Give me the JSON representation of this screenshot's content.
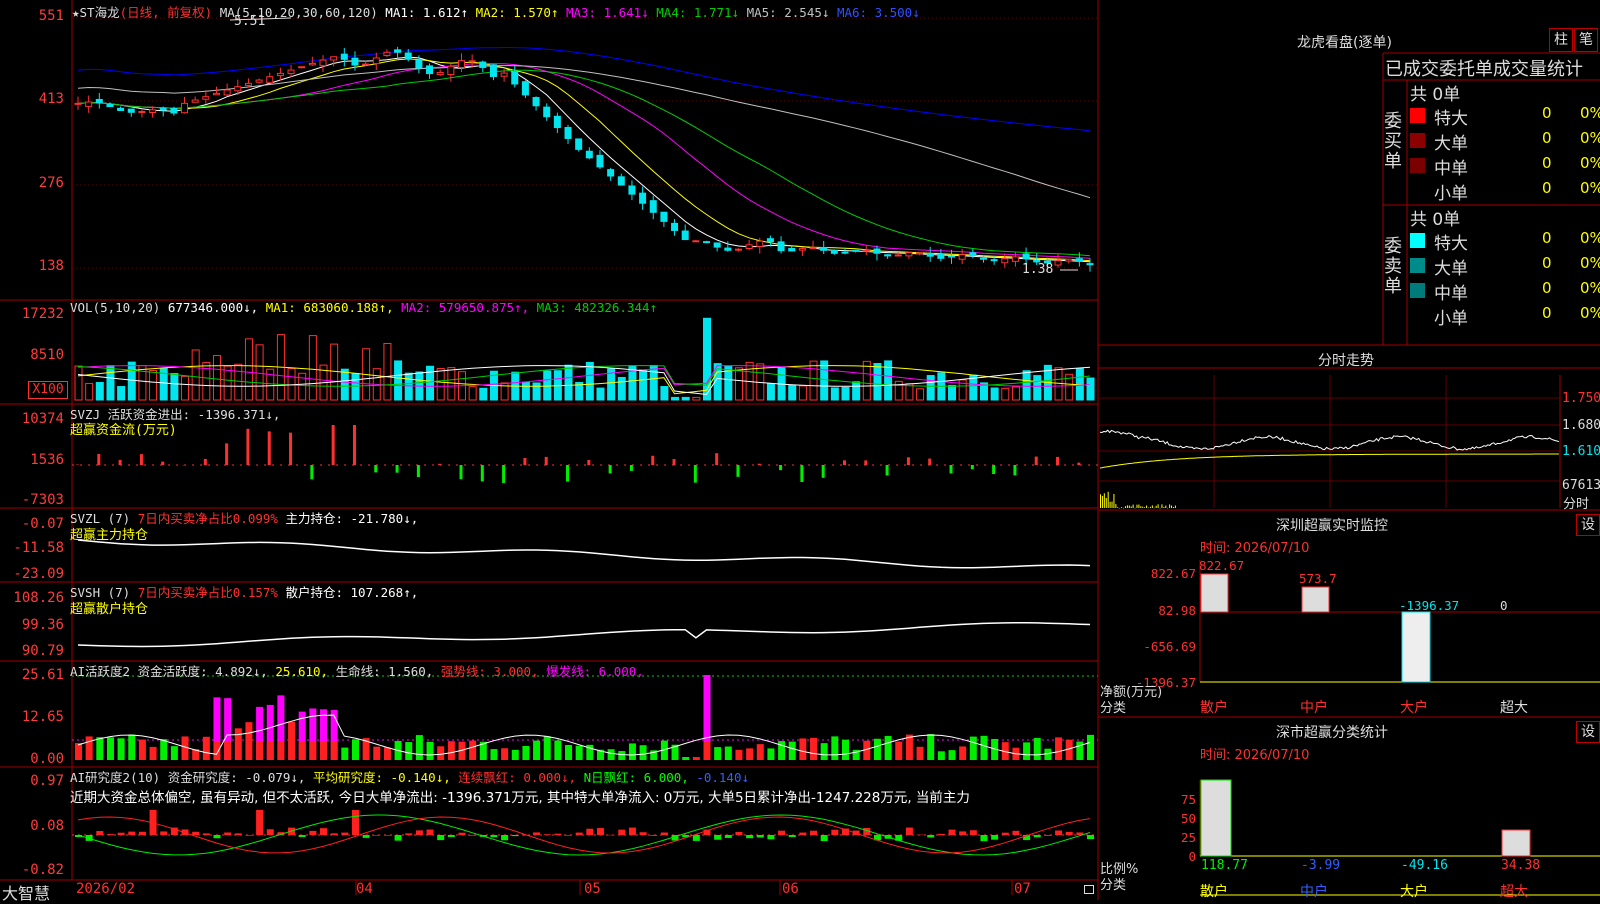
{
  "colors": {
    "up": "#ff3030",
    "down": "#00e5ee",
    "ma1": "#ffffff",
    "ma2": "#ffff00",
    "ma3": "#ff00ff",
    "ma4": "#00cc00",
    "ma5": "#c0c0c0",
    "ma6": "#0000ff",
    "border": "#a00000"
  },
  "main_chart": {
    "header_stock": "★ST海龙",
    "header_period": "(日线, 前复权)",
    "ma_param": "MA(5,10,20,30,60,120)",
    "ma1": "MA1: 1.612↑",
    "ma2": "MA2: 1.570↑",
    "ma3": "MA3: 1.641↓",
    "ma4": "MA4: 1.771↓",
    "ma5": "MA5: 2.545↓",
    "ma6": "MA6: 3.500↓",
    "y_labels": [
      "551",
      "413",
      "276",
      "138"
    ],
    "high_label": "5.51",
    "low_label": "1.38"
  },
  "vol_panel": {
    "header": "VOL(5,10,20)",
    "value": "677346.000↓,",
    "ma1": "MA1: 683060.188↑,",
    "ma2": "MA2: 579650.875↑,",
    "ma3": "MA3: 482326.344↑",
    "y_labels": [
      "17232",
      "8510"
    ],
    "unit": "X100"
  },
  "svzj_panel": {
    "header": "SVZJ  活跃资金进出: -1396.371↓,",
    "subtitle": "超赢资金流(万元)",
    "y_labels": [
      "10374",
      "1536",
      "-7303"
    ]
  },
  "svzl_panel": {
    "header1": "SVZL (7)",
    "header2": "7日内买卖净占比0.099%",
    "header3": "主力持仓: -21.780↓,",
    "subtitle": "超赢主力持仓",
    "y_labels": [
      "-0.07",
      "-11.58",
      "-23.09"
    ]
  },
  "svsh_panel": {
    "header1": "SVSH (7)",
    "header2": "7日内买卖净占比0.157%",
    "header3": "散户持仓: 107.268↑,",
    "subtitle": "超赢散户持仓",
    "y_labels": [
      "108.26",
      "99.36",
      "90.79"
    ]
  },
  "ai_active_panel": {
    "header1": "AI活跃度2 资金活跃度: 4.892↓,",
    "header2": "25.610,",
    "header3": "生命线: 1.560,",
    "header4": "强势线: 3.000,",
    "header5": "爆发线: 6.000,",
    "y_labels": [
      "25.61",
      "12.65",
      "0.00"
    ]
  },
  "ai_research_panel": {
    "header1": "AI研究度2(10) 资金研究度: -0.079↓,",
    "header2": "平均研究度: -0.140↓,",
    "header3": "连续飘红: 0.000↓,",
    "header4": "N日飘红: 6.000,",
    "header5": "-0.140↓",
    "comment": "近期大资金总体偏空, 虽有异动, 但不太活跃, 今日大单净流出: -1396.371万元, 其中特大单净流入: 0万元, 大单5日累计净出-1247.228万元, 当前主力",
    "y_labels": [
      "0.97",
      "0.08",
      "-0.82"
    ]
  },
  "x_axis": {
    "labels": [
      "2026/02",
      "04",
      "05",
      "06",
      "07"
    ],
    "logo": "大智慧"
  },
  "dragon_tiger": {
    "title": "龙虎看盘(逐单)",
    "btn1": "柱",
    "btn2": "笔",
    "subtitle": "已成交委托单成交量统计",
    "buy_label": "委买单",
    "sell_label": "委卖单",
    "buy_total": "共 0单",
    "sell_total": "共 0单",
    "buy_rows": [
      {
        "name": "特大",
        "count": "0",
        "pct": "0%",
        "color": "#ff0000"
      },
      {
        "name": "大单",
        "count": "0",
        "pct": "0%",
        "color": "#8b0000"
      },
      {
        "name": "中单",
        "count": "0",
        "pct": "0%",
        "color": "#7a0000"
      },
      {
        "name": "小单",
        "count": "0",
        "pct": "0%",
        "color": "#000000"
      }
    ],
    "sell_rows": [
      {
        "name": "特大",
        "count": "0",
        "pct": "0%",
        "color": "#00ffff"
      },
      {
        "name": "大单",
        "count": "0",
        "pct": "0%",
        "color": "#008b8b"
      },
      {
        "name": "中单",
        "count": "0",
        "pct": "0%",
        "color": "#007b7b"
      },
      {
        "name": "小单",
        "count": "0",
        "pct": "0%",
        "color": "#000000"
      }
    ]
  },
  "intraday": {
    "title": "分时走势",
    "y_labels": [
      "1.750",
      "1.680",
      "1.610",
      "67613"
    ],
    "unit": "分时"
  },
  "sz_monitor": {
    "title": "深圳超赢实时监控",
    "set_btn": "设",
    "time": "时间: 2026/07/10",
    "y_labels": [
      "822.67",
      "82.98",
      "-656.69",
      "-1396.37"
    ],
    "bar_labels": [
      "822.67",
      "573.7",
      "-1396.37",
      "0"
    ],
    "ylabel": "净额(万元)",
    "xlabel": "分类",
    "categories": [
      "散户",
      "中户",
      "大户",
      "超大"
    ]
  },
  "sz_stats": {
    "title": "深市超赢分类统计",
    "set_btn": "设",
    "time": "时间: 2026/07/10",
    "y_labels": [
      "75",
      "50",
      "25",
      "0"
    ],
    "values": [
      "118.77",
      "-3.99",
      "-49.16",
      "34.38"
    ],
    "ylabel": "比例%",
    "xlabel": "分类",
    "categories": [
      "散户",
      "中户",
      "大户",
      "超大"
    ]
  }
}
